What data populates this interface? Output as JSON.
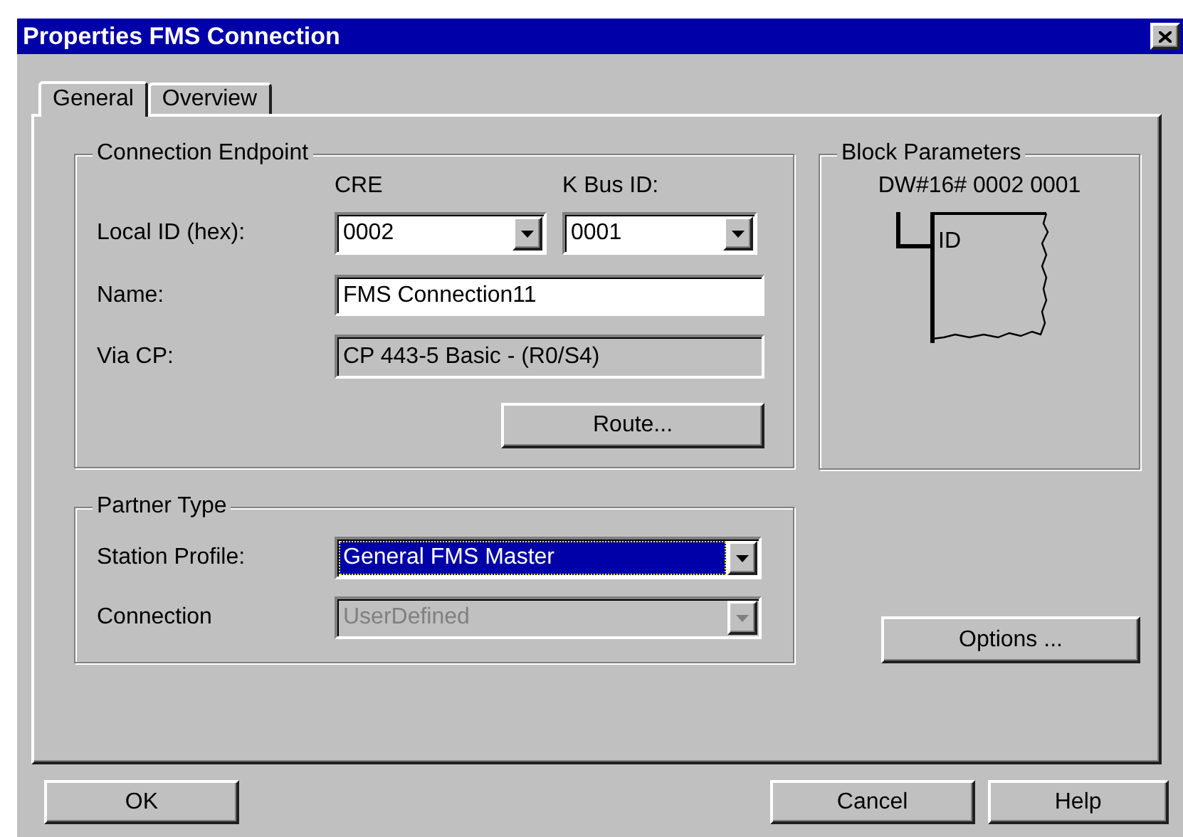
{
  "window": {
    "title": "Properties FMS Connection"
  },
  "tabs": [
    {
      "label": "General",
      "selected": true
    },
    {
      "label": "Overview",
      "selected": false
    }
  ],
  "connection_endpoint": {
    "title": "Connection Endpoint",
    "column_headers": [
      "CRE",
      "K Bus ID:"
    ],
    "local_id": {
      "label": "Local ID (hex):",
      "cre": "0002",
      "k_bus_id": "0001"
    },
    "name": {
      "label": "Name:",
      "value": "FMS Connection11"
    },
    "via_cp": {
      "label": "Via CP:",
      "value": "CP 443-5 Basic - (R0/S4)",
      "disabled": true
    },
    "route_button": "Route..."
  },
  "block_parameters": {
    "title": "Block Parameters",
    "value": "DW#16# 0002 0001",
    "pin_label": "ID"
  },
  "partner_type": {
    "title": "Partner Type",
    "station_profile": {
      "label": "Station Profile:",
      "value": "General FMS Master",
      "selected": true,
      "disabled": false
    },
    "connection": {
      "label": "Connection",
      "value": "UserDefined",
      "selected": false,
      "disabled": true
    }
  },
  "options_button": "Options ...",
  "buttons": [
    "OK",
    "Cancel",
    "Help"
  ]
}
